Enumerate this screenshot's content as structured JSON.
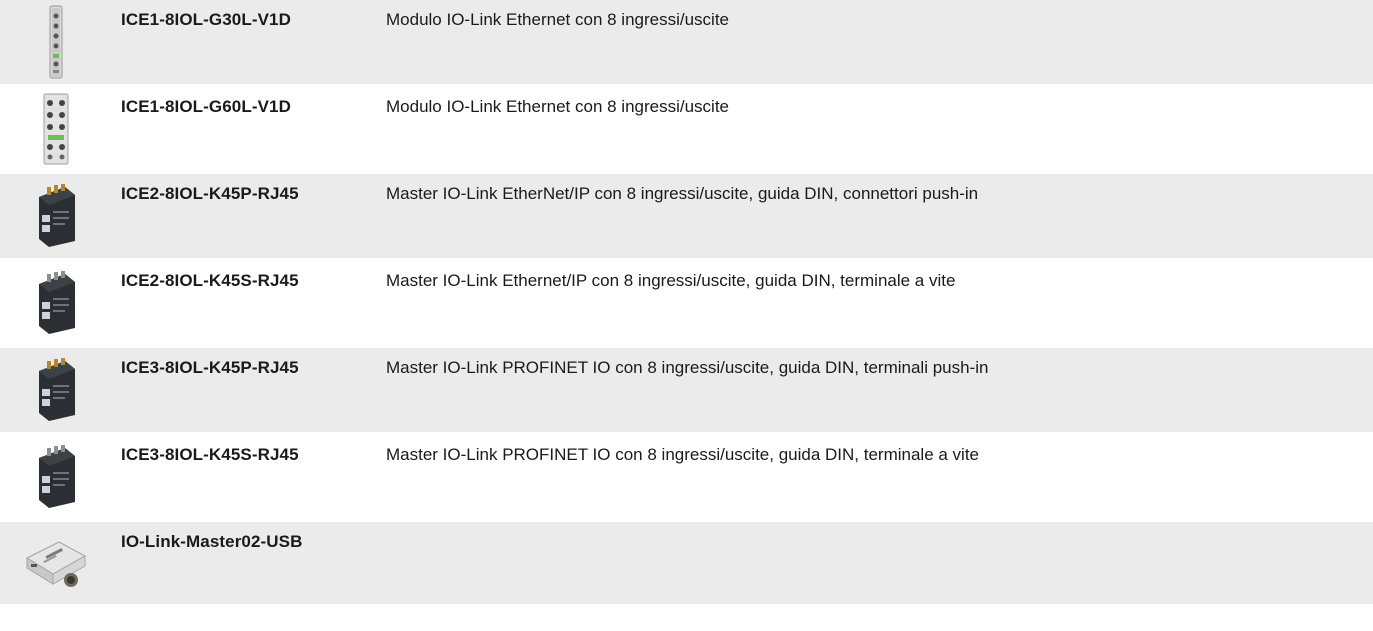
{
  "products": [
    {
      "code": "ICE1-8IOL-G30L-V1D",
      "description": "Modulo IO-Link Ethernet con 8 ingressi/uscite",
      "icon": "io-link-module-slim-icon"
    },
    {
      "code": "ICE1-8IOL-G60L-V1D",
      "description": "Modulo IO-Link Ethernet con 8 ingressi/uscite",
      "icon": "io-link-module-wide-icon"
    },
    {
      "code": "ICE2-8IOL-K45P-RJ45",
      "description": "Master IO-Link EtherNet/IP con 8 ingressi/uscite, guida DIN, connettori push-in",
      "icon": "din-rail-master-icon"
    },
    {
      "code": "ICE2-8IOL-K45S-RJ45",
      "description": "Master IO-Link Ethernet/IP con 8 ingressi/uscite, guida DIN, terminale a vite",
      "icon": "din-rail-master-icon"
    },
    {
      "code": "ICE3-8IOL-K45P-RJ45",
      "description": "Master IO-Link PROFINET IO con 8 ingressi/uscite, guida DIN, terminali push-in",
      "icon": "din-rail-master-icon"
    },
    {
      "code": "ICE3-8IOL-K45S-RJ45",
      "description": "Master IO-Link PROFINET IO con 8 ingressi/uscite, guida DIN, terminale a vite",
      "icon": "din-rail-master-icon"
    },
    {
      "code": "IO-Link-Master02-USB",
      "description": "",
      "icon": "usb-master-icon"
    }
  ]
}
